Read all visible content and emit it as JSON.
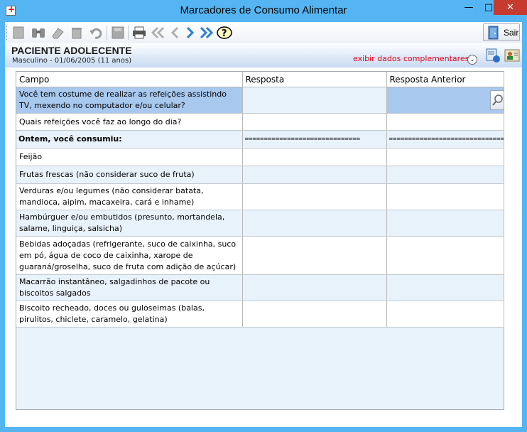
{
  "window": {
    "title": "Marcadores de Consumo Alimentar",
    "min_glyph": "—",
    "max_glyph": "□",
    "close_glyph": "✕"
  },
  "toolbar": {
    "sair_label": "Sair",
    "icons": [
      "new-icon",
      "binoculars-icon",
      "eraser-icon",
      "trash-icon",
      "undo-icon",
      "save-icon",
      "print-icon",
      "first-icon",
      "previous-icon",
      "next-icon",
      "last-icon",
      "help-icon",
      "exit-door-icon"
    ]
  },
  "patient": {
    "name": "PACIENTE ADOLECENTE",
    "details": "Masculino - 01/06/2005 (11 anos)",
    "extra_link": "exibir dados complementares..."
  },
  "table": {
    "headers": [
      "Campo",
      "Resposta",
      "Resposta Anterior"
    ],
    "rows": [
      {
        "campo": "Você tem costume de realizar as refeições assistindo TV, mexendo no computador e/ou celular?",
        "resposta": "",
        "anterior": ""
      },
      {
        "campo": "Quais refeições você faz ao longo do dia?",
        "resposta": "",
        "anterior": ""
      },
      {
        "campo": "Ontem, você consumiu:",
        "resposta": "==============================",
        "anterior": "================================"
      },
      {
        "campo": "Feijão",
        "resposta": "",
        "anterior": ""
      },
      {
        "campo": "Frutas frescas (não considerar suco de fruta)",
        "resposta": "",
        "anterior": ""
      },
      {
        "campo": "Verduras e/ou legumes (não considerar batata, mandioca, aipim, macaxeira, cará e inhame)",
        "resposta": "",
        "anterior": ""
      },
      {
        "campo": "Hambúrguer e/ou embutidos (presunto, mortandela, salame, linguiça, salsicha)",
        "resposta": "",
        "anterior": ""
      },
      {
        "campo": "Bebidas adoçadas (refrigerante, suco de caixinha, suco em pó, água de coco de caixinha, xarope de guaraná/groselha, suco de fruta com adição de açúcar)",
        "resposta": "",
        "anterior": ""
      },
      {
        "campo": "Macarrão instantâneo, salgadinhos de pacote ou biscoitos salgados",
        "resposta": "",
        "anterior": ""
      },
      {
        "campo": "Biscoito recheado, doces ou guloseimas (balas, pirulitos, chiclete, caramelo, gelatina)",
        "resposta": "",
        "anterior": ""
      }
    ]
  },
  "colors": {
    "window_frame": "#55b5f2",
    "close_button": "#c73a2e",
    "selected_row": "#a8c8ee",
    "alt_row": "#e8f2fb",
    "link_red": "#e0001a"
  }
}
